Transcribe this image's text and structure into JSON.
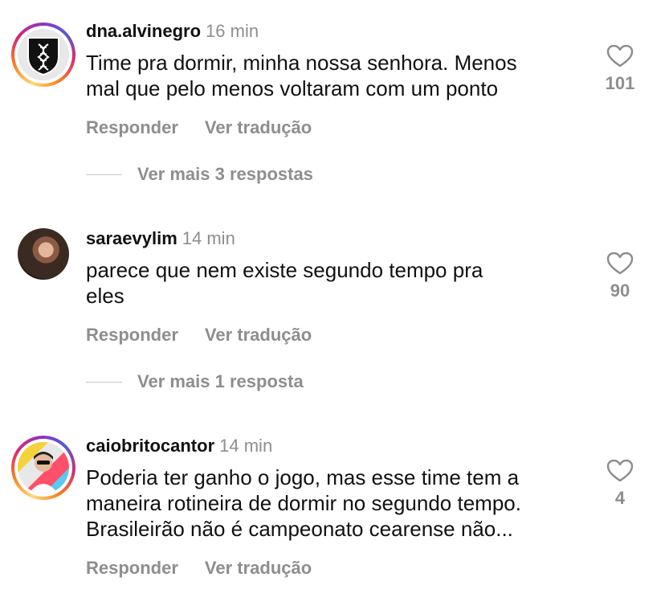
{
  "comments": [
    {
      "username": "dna.alvinegro",
      "time": "16 min",
      "text_lines": [
        "Time pra dormir, minha nossa senhora. Menos",
        "mal que pelo menos voltaram com um ponto"
      ],
      "likes": "101",
      "reply_label": "Responder",
      "translate_label": "Ver tradução",
      "more_replies": "Ver mais 3 respostas",
      "avatar_icon": "dna-shield-icon"
    },
    {
      "username": "saraevylim",
      "time": "14 min",
      "text_lines": [
        "parece que nem existe segundo tempo pra",
        "eles"
      ],
      "likes": "90",
      "reply_label": "Responder",
      "translate_label": "Ver tradução",
      "more_replies": "Ver mais 1 resposta",
      "avatar_icon": "profile-photo"
    },
    {
      "username": "caiobritocantor",
      "time": "14 min",
      "text_lines": [
        "Poderia ter ganho o jogo, mas esse time tem a",
        "maneira rotineira de dormir no segundo tempo.",
        "Brasileirão não é campeonato cearense não..."
      ],
      "likes": "4",
      "reply_label": "Responder",
      "translate_label": "Ver tradução",
      "avatar_icon": "profile-photo"
    }
  ],
  "colors": {
    "text": "#111111",
    "muted": "#8e8e8e",
    "story_ring": [
      "#feda75",
      "#fa7e1e",
      "#d62976",
      "#962fbf",
      "#4f5bd5"
    ]
  }
}
